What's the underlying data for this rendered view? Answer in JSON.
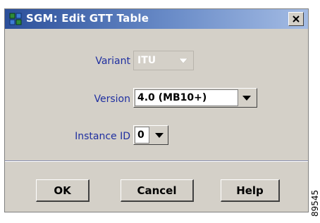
{
  "window": {
    "title": "SGM: Edit GTT Table",
    "close_icon": "close-icon"
  },
  "form": {
    "variant": {
      "label": "Variant",
      "value": "ITU",
      "enabled": false
    },
    "version": {
      "label": "Version",
      "value": "4.0  (MB10+)",
      "enabled": true
    },
    "instance_id": {
      "label": "Instance ID",
      "value": "0",
      "enabled": true
    }
  },
  "buttons": {
    "ok": "OK",
    "cancel": "Cancel",
    "help": "Help"
  },
  "figure_id": "89545",
  "colors": {
    "dialog_bg": "#d4d0c8",
    "label_text": "#1f2fa0",
    "title_gradient_start": "#2b4f9a"
  }
}
